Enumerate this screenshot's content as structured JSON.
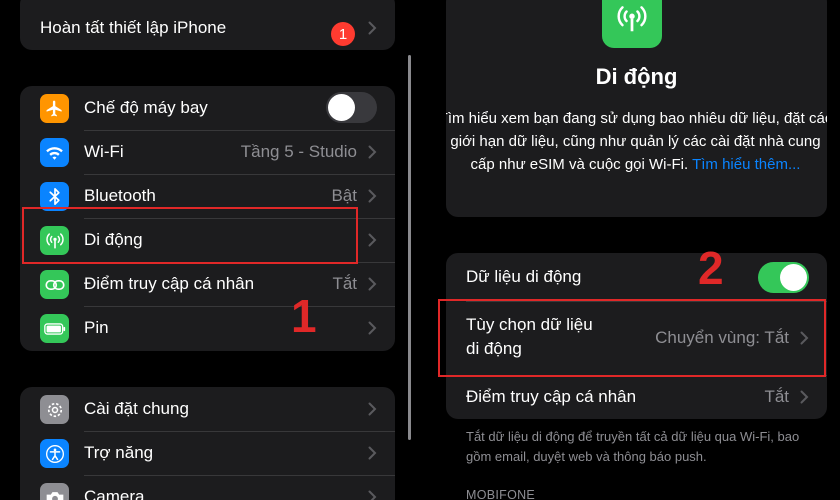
{
  "left": {
    "setup_row": {
      "label": "Hoàn tất thiết lập iPhone",
      "badge": "1"
    },
    "network_rows": [
      {
        "label": "Chế độ máy bay",
        "value": ""
      },
      {
        "label": "Wi-Fi",
        "value": "Tầng 5 - Studio"
      },
      {
        "label": "Bluetooth",
        "value": "Bật"
      },
      {
        "label": "Di động",
        "value": ""
      },
      {
        "label": "Điểm truy cập cá nhân",
        "value": "Tắt"
      },
      {
        "label": "Pin",
        "value": ""
      }
    ],
    "general_rows": [
      {
        "label": "Cài đặt chung"
      },
      {
        "label": "Trợ năng"
      },
      {
        "label": "Camera"
      }
    ],
    "marker": "1"
  },
  "right": {
    "header_title": "Di động",
    "description": "Tìm hiểu xem bạn đang sử dụng bao nhiêu dữ liệu, đặt các giới hạn dữ liệu, cũng như quản lý các cài đặt nhà cung cấp như eSIM và cuộc gọi Wi-Fi.",
    "learn_more": "Tìm hiểu thêm...",
    "cellular_data_label": "Dữ liệu di động",
    "options_label_1": "Tùy chọn dữ liệu",
    "options_label_2": "di động",
    "options_value": "Chuyển vùng: Tắt",
    "hotspot_label": "Điểm truy cập cá nhân",
    "hotspot_value": "Tắt",
    "footer_text": "Tắt dữ liệu di động để truyền tất cả dữ liệu qua Wi-Fi, bao gồm email, duyệt web và thông báo push.",
    "section_header": "MOBIFONE",
    "marker": "2"
  },
  "colors": {
    "airplane": "#ff9500",
    "wifi": "#0a84ff",
    "bluetooth": "#0a84ff",
    "cellular": "#34c759",
    "hotspot": "#34c759",
    "battery": "#34c759",
    "general": "#8e8e93",
    "accessibility": "#0a84ff",
    "camera": "#8e8e93",
    "highlight": "#e02828"
  },
  "state": {
    "airplane_mode_on": false,
    "cellular_data_on": true
  }
}
